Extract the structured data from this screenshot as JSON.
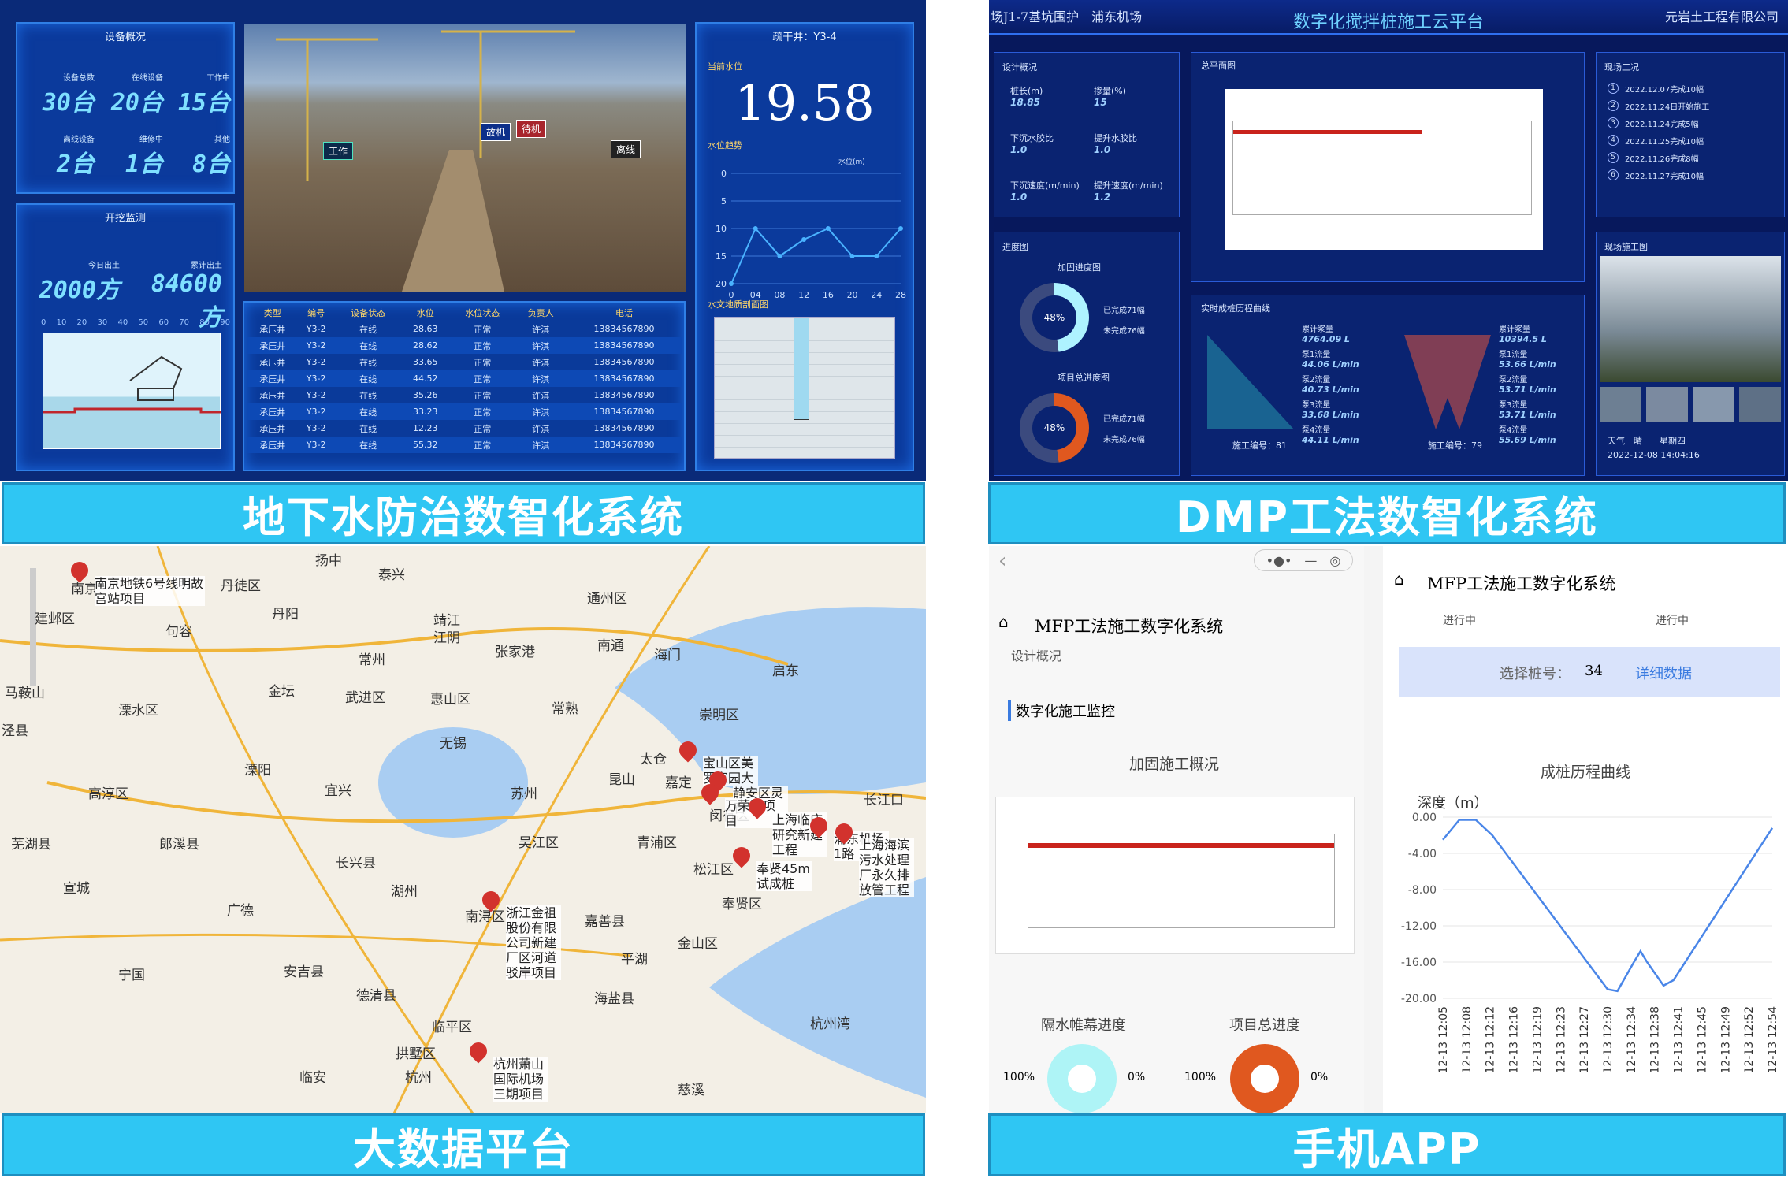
{
  "captions": {
    "c1": "地下水防治数智化系统",
    "c2": "DMP工法数智化系统",
    "c3": "大数据平台",
    "c4": "手机APP"
  },
  "d1": {
    "overview": "设备概况",
    "kpis": [
      {
        "label": "设备总数",
        "value": "30台"
      },
      {
        "label": "在线设备",
        "value": "20台"
      },
      {
        "label": "工作中",
        "value": "15台"
      },
      {
        "label": "离线设备",
        "value": "2台"
      },
      {
        "label": "维修中",
        "value": "1台"
      },
      {
        "label": "其他",
        "value": "8台"
      }
    ],
    "excav": "开挖监测",
    "today_label": "今日出土",
    "today_value": "2000方",
    "total_label": "累计出土",
    "total_value": "84600方",
    "ruler": [
      "0",
      "10",
      "20",
      "30",
      "40",
      "50",
      "60",
      "70",
      "80",
      "90"
    ],
    "video_tags": [
      "工作",
      "故机",
      "待机",
      "离线"
    ],
    "well_title": "疏干井：Y3-4",
    "level_label": "当前水位",
    "level_value": "19.58",
    "trend_label": "水位趋势",
    "legend": "水位(m)",
    "yticks": [
      "0",
      "5",
      "10",
      "15",
      "20"
    ],
    "xticks": [
      "0",
      "04",
      "08",
      "12",
      "16",
      "20",
      "24",
      "28"
    ],
    "geo_label": "水文地质剖面图",
    "table_headers": [
      "类型",
      "编号",
      "设备状态",
      "水位",
      "水位状态",
      "负责人",
      "电话"
    ],
    "rows": [
      [
        "承压井",
        "Y3-2",
        "在线",
        "28.63",
        "正常",
        "许淇",
        "13834567890"
      ],
      [
        "承压井",
        "Y3-2",
        "在线",
        "28.62",
        "正常",
        "许淇",
        "13834567890"
      ],
      [
        "承压井",
        "Y3-2",
        "在线",
        "33.65",
        "正常",
        "许淇",
        "13834567890"
      ],
      [
        "承压井",
        "Y3-2",
        "在线",
        "44.52",
        "正常",
        "许淇",
        "13834567890"
      ],
      [
        "承压井",
        "Y3-2",
        "在线",
        "35.26",
        "正常",
        "许淇",
        "13834567890"
      ],
      [
        "承压井",
        "Y3-2",
        "在线",
        "33.23",
        "正常",
        "许淇",
        "13834567890"
      ],
      [
        "承压井",
        "Y3-2",
        "在线",
        "12.23",
        "正常",
        "许淇",
        "13834567890"
      ],
      [
        "承压井",
        "Y3-2",
        "在线",
        "55.32",
        "正常",
        "许淇",
        "13834567890"
      ]
    ]
  },
  "chart_data": {
    "type": "line",
    "title": "水位趋势",
    "x": [
      "0",
      "04",
      "08",
      "12",
      "16",
      "20",
      "24",
      "28"
    ],
    "series": [
      {
        "name": "水位(m)",
        "values": [
          20,
          10,
          15,
          12,
          10,
          15,
          15,
          10
        ]
      }
    ],
    "ylim": [
      0,
      20
    ]
  },
  "d2": {
    "header_left": "场J1-7基坑围护　浦东机场",
    "title": "数字化搅拌桩施工云平台",
    "header_right": "元岩土工程有限公司",
    "design": "设计概况",
    "f": [
      {
        "l": "桩长(m)",
        "v": "18.85"
      },
      {
        "l": "掺量(%)",
        "v": "15"
      },
      {
        "l": "下沉水胶比",
        "v": "1.0"
      },
      {
        "l": "提升水胶比",
        "v": "1.0"
      },
      {
        "l": "下沉速度(m/min)",
        "v": "1.0"
      },
      {
        "l": "提升速度(m/min)",
        "v": "1.2"
      }
    ],
    "plan": "总平面图",
    "progress": "进度图",
    "donut1": "加固进度图",
    "donut2": "项目总进度图",
    "pct": "48%",
    "done": "已完成71幅",
    "undone": "未完成76幅",
    "curve": "实时成桩历程曲线",
    "pile1": "施工编号：81",
    "pile2": "施工编号：79",
    "flows1": [
      {
        "l": "累计浆量",
        "v": "4764.09 L"
      },
      {
        "l": "泵1流量",
        "v": "44.06 L/min"
      },
      {
        "l": "泵2流量",
        "v": "40.73 L/min"
      },
      {
        "l": "泵3流量",
        "v": "33.68 L/min"
      },
      {
        "l": "泵4流量",
        "v": "44.11 L/min"
      }
    ],
    "flows2": [
      {
        "l": "累计浆量",
        "v": "10394.5 L"
      },
      {
        "l": "泵1流量",
        "v": "53.66 L/min"
      },
      {
        "l": "泵2流量",
        "v": "53.71 L/min"
      },
      {
        "l": "泵3流量",
        "v": "53.71 L/min"
      },
      {
        "l": "泵4流量",
        "v": "55.69 L/min"
      }
    ],
    "site": "现场工况",
    "log": [
      "2022.12.07完成10幅",
      "2022.11.24日开始施工",
      "2022.11.24完成5幅",
      "2022.11.25完成10幅",
      "2022.11.26完成8幅",
      "2022.11.27完成10幅"
    ],
    "photo_label": "现场施工图",
    "weather": "天气　晴　　星期四",
    "datetime": "2022-12-08 14:04:16"
  },
  "map": {
    "labels": [
      "南京",
      "建邺区",
      "丹徒区",
      "丹阳",
      "扬中",
      "泰兴",
      "靖江",
      "江阴",
      "通州区",
      "南通",
      "海门",
      "启东",
      "金坛",
      "常州",
      "武进区",
      "张家港",
      "惠山区",
      "常熟",
      "崇明区",
      "溧水区",
      "溧阳",
      "宜兴",
      "无锡",
      "苏州",
      "昆山",
      "太仓",
      "嘉定",
      "高淳区",
      "郎溪县",
      "长兴县",
      "湖州",
      "吴江区",
      "青浦区",
      "闵行区",
      "松江区",
      "奉贤区",
      "嘉善县",
      "平湖",
      "金山区",
      "海盐县",
      "南浔区",
      "安吉县",
      "德清县",
      "广德",
      "宁国",
      "宣城",
      "芜湖县",
      "临平区",
      "拱墅区",
      "杭州",
      "临安",
      "杭州湾",
      "慈溪",
      "长江口",
      "句容",
      "马鞍山",
      "泾县"
    ],
    "pins": [
      "南京地铁6号线明故宫站项目",
      "宝山区美罗家园大",
      "静安区灵石",
      "万荣路项目",
      "上海临床研究新建工程",
      "浦东机场1路",
      "奉贤45m试成桩",
      "上海海滨污水处理厂永久排放管工程",
      "浙江金祖股份有限公司新建厂区河道驳岸项目",
      "杭州萧山国际机场三期项目"
    ]
  },
  "ph": {
    "left_title": "MFP工法施工数字化系统",
    "design_collapsed": "设计概况",
    "monitor": "数字化施工监控",
    "reinforce": "加固施工概况",
    "curtain": "隔水帷幕进度",
    "total": "项目总进度",
    "p100": "100%",
    "p0": "0%",
    "right_title": "MFP工法施工数字化系统",
    "inprog": "进行中",
    "pick_label": "选择桩号：",
    "pick_value": "34",
    "detail": "详细数据",
    "curve_title": "成桩历程曲线",
    "depth_label": "深度（m）",
    "yticks": [
      "0.00",
      "-4.00",
      "-8.00",
      "-12.00",
      "-16.00",
      "-20.00"
    ],
    "xticks": [
      "12-13 12:05",
      "12-13 12:08",
      "12-13 12:12",
      "12-13 12:16",
      "12-13 12:19",
      "12-13 12:23",
      "12-13 12:27",
      "12-13 12:30",
      "12-13 12:34",
      "12-13 12:38",
      "12-13 12:41",
      "12-13 12:45",
      "12-13 12:49",
      "12-13 12:52",
      "12-13 12:54"
    ]
  }
}
